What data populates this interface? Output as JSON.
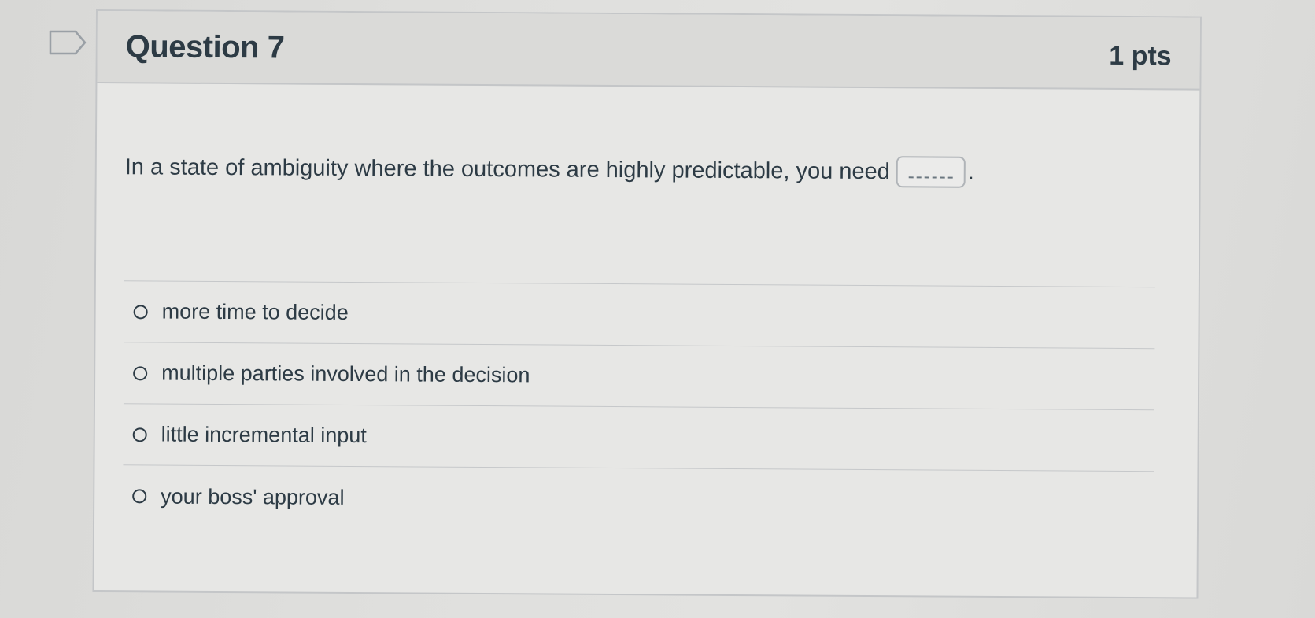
{
  "question": {
    "title": "Question 7",
    "points": "1 pts",
    "prompt": "In a state of ambiguity where the outcomes are highly predictable, you need",
    "blank_placeholder": "_____",
    "prompt_end": "."
  },
  "answers": [
    {
      "label": "more time to decide"
    },
    {
      "label": "multiple parties involved in the decision"
    },
    {
      "label": "little incremental input"
    },
    {
      "label": "your boss' approval"
    }
  ],
  "icons": {
    "flag": "flag-icon",
    "radio": "radio-button-icon"
  }
}
